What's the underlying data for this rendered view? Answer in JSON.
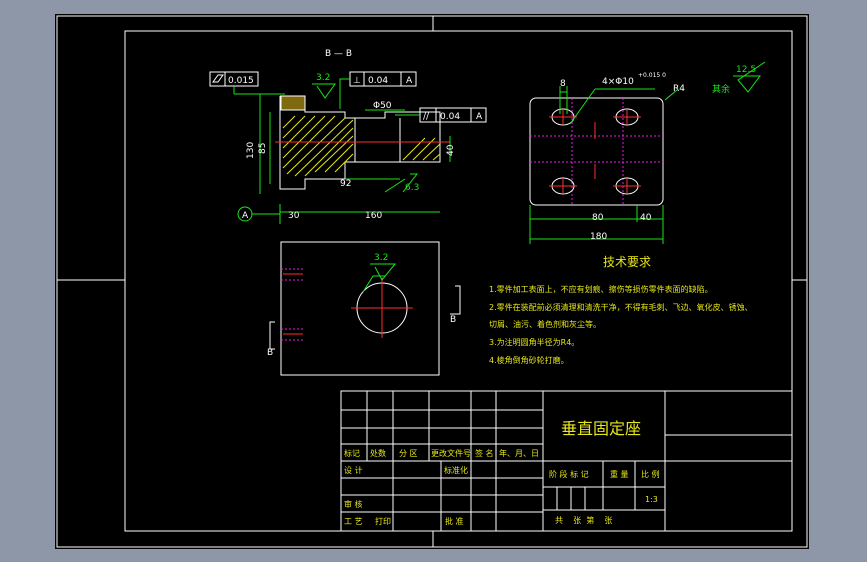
{
  "section_label": "B — B",
  "roughness": {
    "r1": "3.2",
    "r2": "6.3",
    "r3": "3.2",
    "rest_value": "12.5",
    "rest_label": "其余"
  },
  "tolerances": {
    "flatness_value": "0.015",
    "perp_symbol": "⊥",
    "perp_value": "0.04",
    "perp_datum": "A",
    "parallel_symbol": "//",
    "parallel_value": "0.04",
    "parallel_datum": "A",
    "datum_a": "A"
  },
  "dims_left": {
    "d130": "130",
    "d85": "85",
    "phi50": "Φ50",
    "d40": "40",
    "d92": "92",
    "d30": "30",
    "d160": "160"
  },
  "dims_right": {
    "d8": "8",
    "holes": "4×Φ10",
    "hole_tol": "+0.015\n0",
    "r4": "R4",
    "d80": "80",
    "d40": "40",
    "d180": "180"
  },
  "section_marks": {
    "b_upper": "B",
    "b_lower": "B"
  },
  "tech": {
    "title": "技术要求",
    "lines": [
      "1.零件加工表面上，不应有划痕、擦伤等损伤零件表面的缺陷。",
      "2.零件在装配前必须清理和清洗干净，不得有毛刺、飞边、氧化皮、锈蚀、",
      "切屑、油污、着色剂和灰尘等。",
      "3.为注明圆角半径为R4。",
      "4.棱角倒角砂轮打磨。"
    ]
  },
  "title_block": {
    "part_name": "垂直固定座",
    "row_headers": [
      "标记",
      "处数",
      "分 区",
      "更改文件号",
      "签 名",
      "年、月、日"
    ],
    "design": "设 计",
    "standard": "标准化",
    "stage_mark": "阶 段 标 记",
    "weight": "重 量",
    "scale_label": "比 例",
    "scale": "1:3",
    "review": "审 核",
    "process": "工 艺",
    "print": "打印",
    "approve": "批 准",
    "sheets": "共    张  第    张"
  }
}
